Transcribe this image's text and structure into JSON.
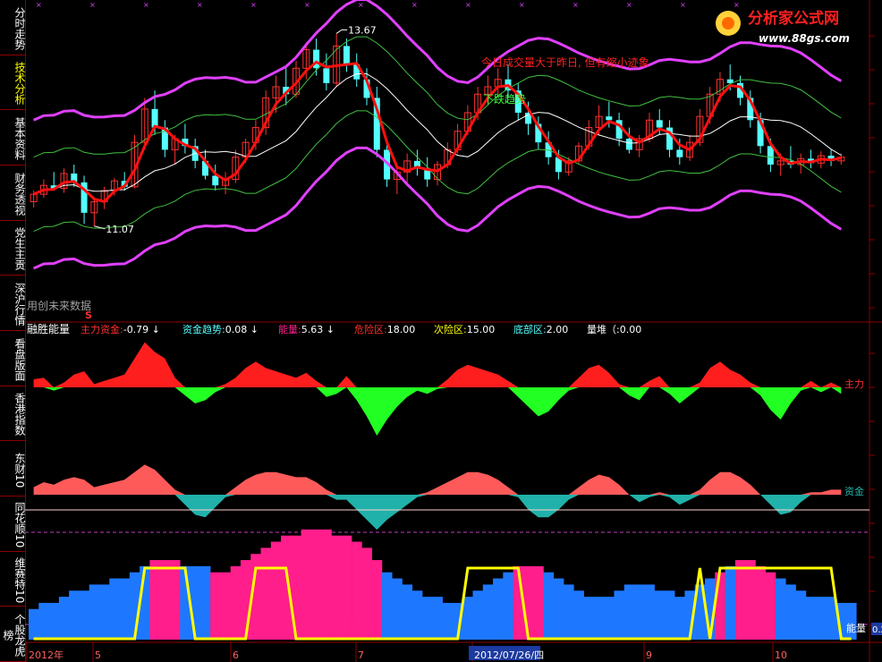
{
  "sidebar": {
    "tabs": [
      {
        "label": "分时走势",
        "active": false
      },
      {
        "label": "技术分析",
        "active": true
      },
      {
        "label": "基本资料",
        "active": false
      },
      {
        "label": "财务透视",
        "active": false
      },
      {
        "label": "党生主贡",
        "active": false
      },
      {
        "label": "深沪行情",
        "active": false
      },
      {
        "label": "看盘版面",
        "active": false
      },
      {
        "label": "香港指数",
        "active": false
      },
      {
        "label": "东财10",
        "active": false
      },
      {
        "label": "同花顺10",
        "active": false
      },
      {
        "label": "维赛特10",
        "active": false
      },
      {
        "label": "个股龙虎榜",
        "active": false
      }
    ]
  },
  "logo": {
    "name": "分析家公式网",
    "url": "www.88gs.com"
  },
  "colors": {
    "background": "#000000",
    "up": "#ff3030",
    "down": "#54ffff",
    "upper_band": "#e040ff",
    "mid_band": "#40c040",
    "ma_white": "#ffffff",
    "trend_red": "#ff1010",
    "axis": "#8b0000",
    "label_yellow": "#ffff00",
    "pink": "#ff1e8c",
    "blue": "#1e78ff"
  },
  "chart_data": [
    {
      "type": "candlestick",
      "annotations": {
        "high_label": "13.67",
        "low_label": "11.07",
        "notice1": "今日成交量大于昨日, 但有缩小迹象",
        "notice2": "下跌趋势",
        "footer_note": "用创未来数据",
        "marker": "S"
      },
      "ylim": [
        10.5,
        14.0
      ],
      "ohlc": [
        [
          11.4,
          11.55,
          11.32,
          11.5
        ],
        [
          11.5,
          11.7,
          11.45,
          11.62
        ],
        [
          11.62,
          11.8,
          11.55,
          11.58
        ],
        [
          11.58,
          11.85,
          11.52,
          11.78
        ],
        [
          11.78,
          11.9,
          11.6,
          11.66
        ],
        [
          11.66,
          11.75,
          11.1,
          11.25
        ],
        [
          11.25,
          11.45,
          11.07,
          11.4
        ],
        [
          11.4,
          11.6,
          11.3,
          11.55
        ],
        [
          11.55,
          11.72,
          11.48,
          11.68
        ],
        [
          11.68,
          11.8,
          11.55,
          11.6
        ],
        [
          11.6,
          12.3,
          11.58,
          12.2
        ],
        [
          12.2,
          12.8,
          12.1,
          12.65
        ],
        [
          12.65,
          12.9,
          12.3,
          12.4
        ],
        [
          12.4,
          12.5,
          12.0,
          12.1
        ],
        [
          12.1,
          12.3,
          11.9,
          12.25
        ],
        [
          12.25,
          12.45,
          12.05,
          12.15
        ],
        [
          12.15,
          12.25,
          11.85,
          11.95
        ],
        [
          11.95,
          12.1,
          11.7,
          11.75
        ],
        [
          11.75,
          11.9,
          11.55,
          11.62
        ],
        [
          11.62,
          11.8,
          11.5,
          11.7
        ],
        [
          11.7,
          12.1,
          11.65,
          12.0
        ],
        [
          12.0,
          12.25,
          11.92,
          12.2
        ],
        [
          12.2,
          12.5,
          12.1,
          12.4
        ],
        [
          12.4,
          12.9,
          12.3,
          12.8
        ],
        [
          12.8,
          13.1,
          12.6,
          12.95
        ],
        [
          12.95,
          13.2,
          12.7,
          12.85
        ],
        [
          12.85,
          13.3,
          12.8,
          13.2
        ],
        [
          13.2,
          13.55,
          13.05,
          13.45
        ],
        [
          13.45,
          13.6,
          13.1,
          13.2
        ],
        [
          13.2,
          13.4,
          12.9,
          13.0
        ],
        [
          13.0,
          13.67,
          12.95,
          13.5
        ],
        [
          13.5,
          13.6,
          13.15,
          13.25
        ],
        [
          13.25,
          13.4,
          12.95,
          13.05
        ],
        [
          13.05,
          13.2,
          12.7,
          12.8
        ],
        [
          12.8,
          12.95,
          12.0,
          12.1
        ],
        [
          12.1,
          12.2,
          11.6,
          11.7
        ],
        [
          11.7,
          11.9,
          11.5,
          11.8
        ],
        [
          11.8,
          12.05,
          11.65,
          11.95
        ],
        [
          11.95,
          12.1,
          11.75,
          11.85
        ],
        [
          11.85,
          12.0,
          11.6,
          11.7
        ],
        [
          11.7,
          11.95,
          11.62,
          11.9
        ],
        [
          11.9,
          12.2,
          11.85,
          12.1
        ],
        [
          12.1,
          12.45,
          12.05,
          12.35
        ],
        [
          12.35,
          12.7,
          12.3,
          12.6
        ],
        [
          12.6,
          12.95,
          12.5,
          12.85
        ],
        [
          12.85,
          13.1,
          12.7,
          12.95
        ],
        [
          12.95,
          13.2,
          12.85,
          13.05
        ],
        [
          13.05,
          13.25,
          12.8,
          12.9
        ],
        [
          12.9,
          13.0,
          12.5,
          12.6
        ],
        [
          12.6,
          12.75,
          12.3,
          12.45
        ],
        [
          12.45,
          12.55,
          12.1,
          12.2
        ],
        [
          12.2,
          12.35,
          11.9,
          12.0
        ],
        [
          12.0,
          12.1,
          11.7,
          11.8
        ],
        [
          11.8,
          12.0,
          11.75,
          11.95
        ],
        [
          11.95,
          12.2,
          11.9,
          12.15
        ],
        [
          12.15,
          12.5,
          12.1,
          12.4
        ],
        [
          12.4,
          12.7,
          12.3,
          12.55
        ],
        [
          12.55,
          12.75,
          12.4,
          12.5
        ],
        [
          12.5,
          12.6,
          12.15,
          12.25
        ],
        [
          12.25,
          12.4,
          12.05,
          12.1
        ],
        [
          12.1,
          12.3,
          12.0,
          12.25
        ],
        [
          12.25,
          12.6,
          12.2,
          12.5
        ],
        [
          12.5,
          12.65,
          12.3,
          12.4
        ],
        [
          12.4,
          12.5,
          12.0,
          12.1
        ],
        [
          12.1,
          12.25,
          11.9,
          12.0
        ],
        [
          12.0,
          12.3,
          11.95,
          12.2
        ],
        [
          12.2,
          12.65,
          12.15,
          12.55
        ],
        [
          12.55,
          12.95,
          12.45,
          12.85
        ],
        [
          12.85,
          13.15,
          12.75,
          13.05
        ],
        [
          13.05,
          13.25,
          12.9,
          13.0
        ],
        [
          13.0,
          13.1,
          12.7,
          12.8
        ],
        [
          12.8,
          12.9,
          12.4,
          12.5
        ],
        [
          12.5,
          12.6,
          12.05,
          12.15
        ],
        [
          12.15,
          12.25,
          11.8,
          11.9
        ],
        [
          11.9,
          12.05,
          11.75,
          11.95
        ],
        [
          11.95,
          12.15,
          11.85,
          11.9
        ],
        [
          11.9,
          12.05,
          11.78,
          11.98
        ],
        [
          11.98,
          12.1,
          11.85,
          11.92
        ],
        [
          11.92,
          12.08,
          11.85,
          12.02
        ],
        [
          12.02,
          12.1,
          11.88,
          11.95
        ],
        [
          11.95,
          12.05,
          11.9,
          12.0
        ]
      ]
    },
    {
      "type": "area",
      "title": "融胜能量",
      "legend": [
        {
          "label": "主力资金:",
          "value": "-0.79",
          "arrow": "↓",
          "color": "#ff3030"
        },
        {
          "label": "资金趋势:",
          "value": "0.08",
          "arrow": "↓",
          "color": "#54ffff"
        },
        {
          "label": "能量:",
          "value": "5.63",
          "arrow": "↓",
          "color": "#ff1e8c"
        },
        {
          "label": "危险区:",
          "value": "18.00",
          "arrow": "",
          "color": "#ff3030"
        },
        {
          "label": "次险区:",
          "value": "15.00",
          "arrow": "",
          "color": "#ffff00"
        },
        {
          "label": "底部区:",
          "value": "2.00",
          "arrow": "",
          "color": "#54ffff"
        },
        {
          "label": "量堆（:",
          "value": "0.00",
          "arrow": "",
          "color": "#ffffff"
        }
      ],
      "series": [
        {
          "name": "主力",
          "values": [
            0.5,
            0.6,
            -0.2,
            0.3,
            0.8,
            1.0,
            0.2,
            0.4,
            0.6,
            0.8,
            1.8,
            2.8,
            2.2,
            1.8,
            0.6,
            -0.5,
            -1.0,
            -0.8,
            -0.3,
            0.2,
            0.6,
            1.2,
            1.6,
            1.2,
            1.0,
            0.8,
            0.6,
            0.9,
            0.4,
            -0.6,
            -0.4,
            0.7,
            -0.8,
            -1.8,
            -3.0,
            -2.0,
            -1.2,
            -0.6,
            -0.2,
            -0.4,
            -0.1,
            0.5,
            1.1,
            1.4,
            1.2,
            1.0,
            0.8,
            0.4,
            -0.6,
            -1.2,
            -1.8,
            -1.5,
            -0.8,
            -0.2,
            0.6,
            1.2,
            1.4,
            0.9,
            0.2,
            -0.5,
            -0.8,
            0.4,
            0.7,
            -0.4,
            -1.0,
            -0.5,
            0.3,
            1.2,
            1.6,
            1.1,
            0.8,
            0.3,
            -0.5,
            -1.4,
            -2.0,
            -1.0,
            -0.2,
            0.4,
            -0.3,
            0.3,
            -0.4
          ]
        },
        {
          "name": "资金",
          "values": [
            0.3,
            0.5,
            0.4,
            0.6,
            0.7,
            0.6,
            0.3,
            0.4,
            0.5,
            0.6,
            0.9,
            1.2,
            1.0,
            0.6,
            0.2,
            -0.4,
            -0.8,
            -0.9,
            -0.5,
            -0.1,
            0.3,
            0.6,
            0.8,
            0.9,
            0.9,
            0.8,
            0.7,
            0.7,
            0.5,
            0.2,
            -0.2,
            -0.2,
            -0.6,
            -1.0,
            -1.4,
            -1.0,
            -0.7,
            -0.4,
            -0.1,
            0.1,
            0.3,
            0.5,
            0.7,
            0.9,
            0.9,
            0.8,
            0.6,
            0.3,
            -0.1,
            -0.6,
            -0.9,
            -0.9,
            -0.6,
            -0.2,
            0.3,
            0.6,
            0.8,
            0.7,
            0.4,
            0.0,
            -0.3,
            -0.1,
            0.1,
            -0.1,
            -0.4,
            -0.2,
            0.2,
            0.6,
            0.9,
            0.9,
            0.7,
            0.4,
            0.0,
            -0.4,
            -0.8,
            -0.7,
            -0.3,
            0.1,
            0.1,
            0.2,
            0.2
          ]
        }
      ]
    },
    {
      "type": "bar",
      "series": [
        {
          "name": "能量",
          "values": [
            5,
            6,
            6,
            7,
            8,
            8,
            9,
            9,
            10,
            10,
            11,
            12,
            13,
            13,
            13,
            12,
            12,
            12,
            11,
            11,
            12,
            13,
            14,
            15,
            16,
            17,
            17,
            18,
            18,
            18,
            17,
            17,
            16,
            15,
            13,
            11,
            10,
            9,
            8,
            7,
            7,
            6,
            6,
            7,
            8,
            9,
            10,
            11,
            12,
            12,
            12,
            11,
            10,
            9,
            8,
            7,
            7,
            7,
            8,
            9,
            9,
            9,
            8,
            8,
            7,
            8,
            9,
            10,
            11,
            12,
            13,
            13,
            12,
            11,
            10,
            9,
            8,
            7,
            7,
            7,
            6,
            6
          ]
        },
        {
          "name": "量堆",
          "values": [
            0,
            0,
            0,
            0,
            0,
            0,
            0,
            0,
            0,
            0,
            0,
            1,
            1,
            1,
            1,
            1,
            0,
            0,
            0,
            0,
            0,
            0,
            1,
            1,
            1,
            1,
            0,
            0,
            0,
            0,
            0,
            0,
            0,
            0,
            0,
            0,
            0,
            0,
            0,
            0,
            0,
            0,
            0,
            1,
            1,
            1,
            1,
            1,
            1,
            0,
            0,
            0,
            0,
            0,
            0,
            0,
            0,
            0,
            0,
            0,
            0,
            0,
            0,
            0,
            0,
            0,
            1,
            0,
            1,
            1,
            1,
            1,
            1,
            1,
            1,
            1,
            1,
            1,
            1,
            1,
            0,
            0
          ]
        }
      ],
      "axis_labels": {
        "energy": "能量",
        "main": "主力",
        "fund": "资金"
      }
    }
  ],
  "xaxis": {
    "ticks": [
      "2012年",
      "5",
      "6",
      "7",
      "2012/07/26/四",
      "9",
      "10"
    ],
    "right_value": "0.2"
  }
}
